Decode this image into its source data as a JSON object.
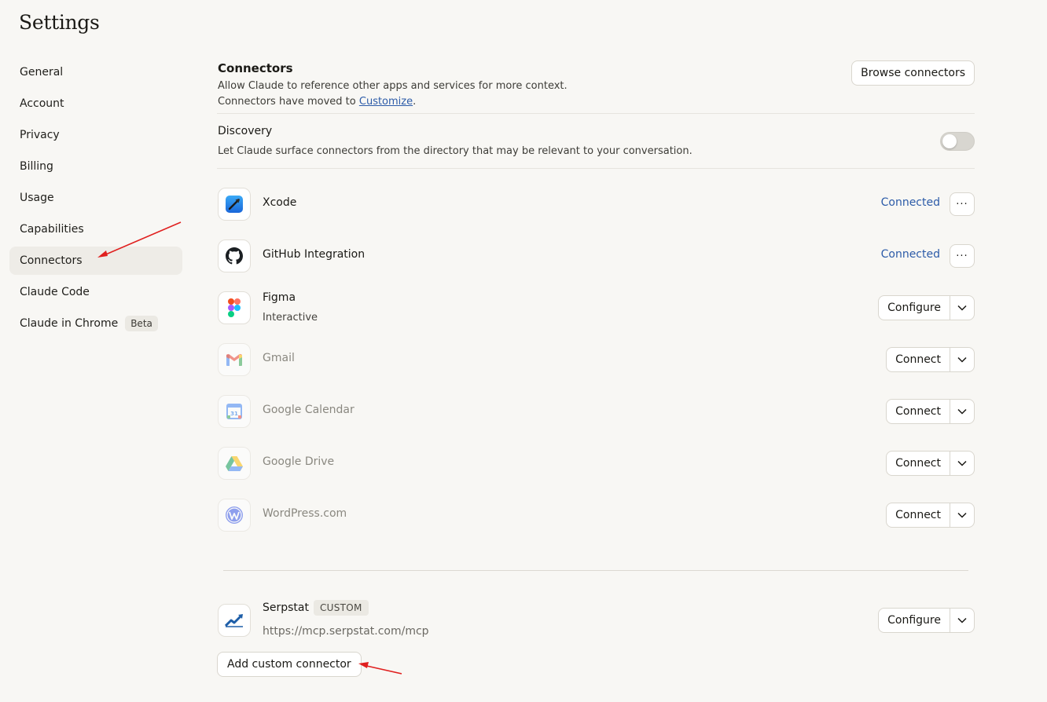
{
  "page": {
    "title": "Settings"
  },
  "sidebar": {
    "items": [
      {
        "label": "General"
      },
      {
        "label": "Account"
      },
      {
        "label": "Privacy"
      },
      {
        "label": "Billing"
      },
      {
        "label": "Usage"
      },
      {
        "label": "Capabilities"
      },
      {
        "label": "Connectors",
        "active": true
      },
      {
        "label": "Claude Code"
      },
      {
        "label": "Claude in Chrome",
        "badge": "Beta"
      }
    ]
  },
  "connectors_section": {
    "title": "Connectors",
    "description": "Allow Claude to reference other apps and services for more context.",
    "moved_prefix": "Connectors have moved to ",
    "moved_link": "Customize",
    "moved_suffix": ".",
    "browse_label": "Browse connectors"
  },
  "discovery": {
    "title": "Discovery",
    "description": "Let Claude surface connectors from the directory that may be relevant to your conversation.",
    "enabled": false
  },
  "connectors": [
    {
      "name": "Xcode",
      "icon": "xcode-icon",
      "status": "Connected",
      "more": "···"
    },
    {
      "name": "GitHub Integration",
      "icon": "github-icon",
      "status": "Connected",
      "more": "···"
    },
    {
      "name": "Figma",
      "icon": "figma-icon",
      "subtitle": "Interactive",
      "action": "Configure"
    },
    {
      "name": "Gmail",
      "icon": "gmail-icon",
      "action": "Connect"
    },
    {
      "name": "Google Calendar",
      "icon": "google-calendar-icon",
      "action": "Connect",
      "icon_text": "31"
    },
    {
      "name": "Google Drive",
      "icon": "google-drive-icon",
      "action": "Connect"
    },
    {
      "name": "WordPress.com",
      "icon": "wordpress-icon",
      "action": "Connect"
    }
  ],
  "custom_connector": {
    "name": "Serpstat",
    "badge": "CUSTOM",
    "url": "https://mcp.serpstat.com/mcp",
    "action": "Configure",
    "icon": "serpstat-icon"
  },
  "add_custom_label": "Add custom connector",
  "colors": {
    "background": "#f8f7f4",
    "link": "#2c5ba8",
    "active_nav": "#eeece7",
    "annotation_arrow": "#e0201f"
  }
}
